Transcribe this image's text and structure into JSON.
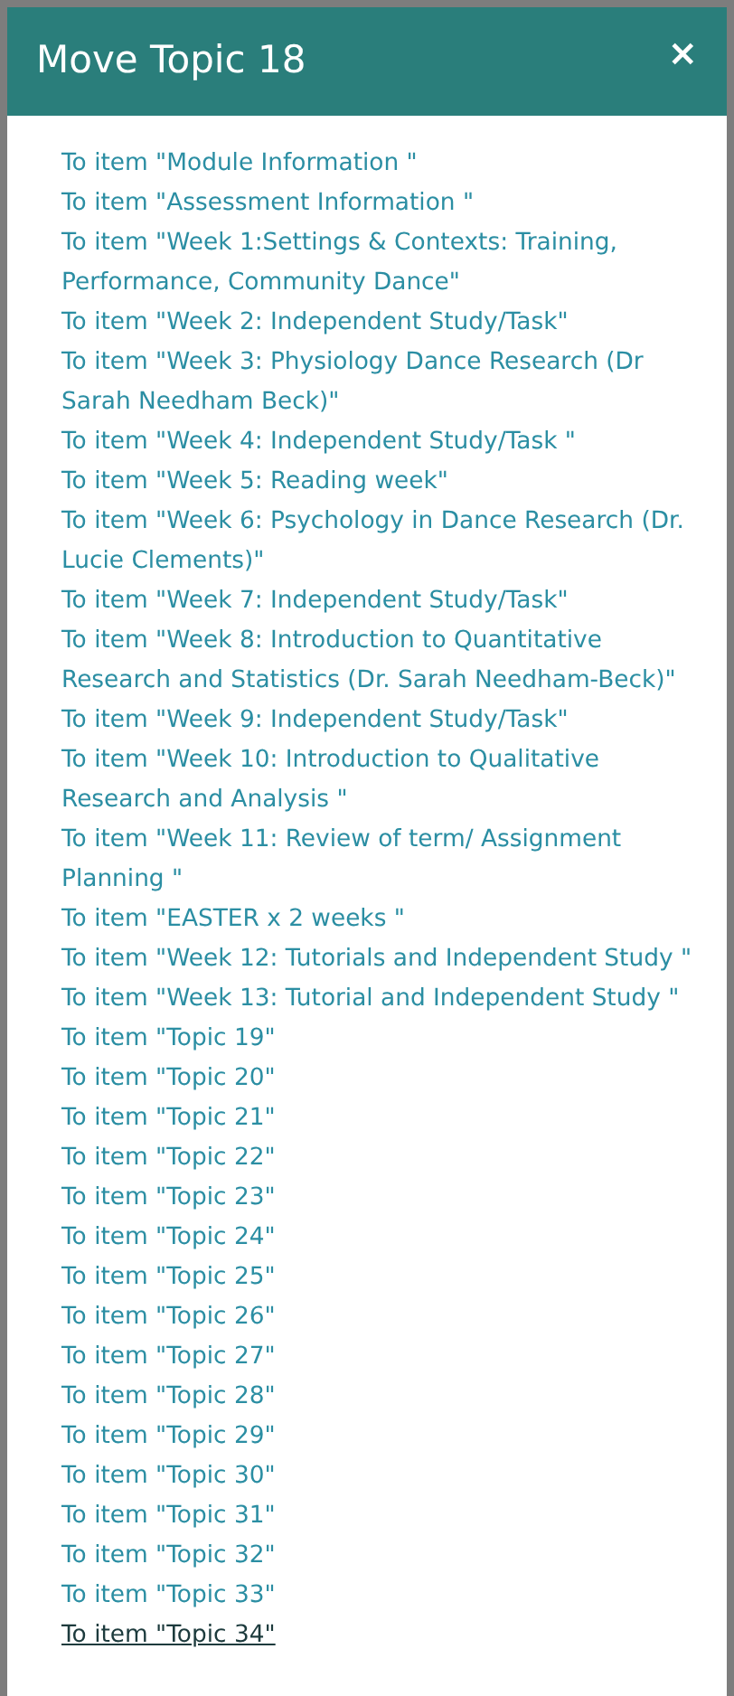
{
  "dialog": {
    "title": "Move Topic 18",
    "close_label": "×"
  },
  "items": [
    {
      "label": "To item \"Module Information \"",
      "hovered": false
    },
    {
      "label": "To item \"Assessment Information \"",
      "hovered": false
    },
    {
      "label": "To item \"Week 1:Settings & Contexts: Training, Performance, Community Dance\"",
      "hovered": false
    },
    {
      "label": "To item \"Week 2: Independent Study/Task\"",
      "hovered": false
    },
    {
      "label": "To item \"Week 3: Physiology Dance Research (Dr Sarah Needham Beck)\"",
      "hovered": false
    },
    {
      "label": "To item \"Week 4: Independent Study/Task \"",
      "hovered": false
    },
    {
      "label": "To item \"Week 5: Reading week\"",
      "hovered": false
    },
    {
      "label": "To item \"Week 6: Psychology in Dance Research (Dr. Lucie Clements)\"",
      "hovered": false
    },
    {
      "label": "To item \"Week 7: Independent Study/Task\"",
      "hovered": false
    },
    {
      "label": "To item \"Week 8: Introduction to Quantitative Research and Statistics (Dr. Sarah Needham-Beck)\"",
      "hovered": false
    },
    {
      "label": "To item \"Week 9: Independent Study/Task\"",
      "hovered": false
    },
    {
      "label": "To item \"Week 10: Introduction to Qualitative Research and Analysis \"",
      "hovered": false
    },
    {
      "label": "To item \"Week 11: Review of term/ Assignment Planning \"",
      "hovered": false
    },
    {
      "label": "To item \"EASTER x 2 weeks \"",
      "hovered": false
    },
    {
      "label": "To item \"Week 12: Tutorials and Independent Study \"",
      "hovered": false
    },
    {
      "label": "To item \"Week 13: Tutorial and Independent Study \"",
      "hovered": false
    },
    {
      "label": "To item \"Topic 19\"",
      "hovered": false
    },
    {
      "label": "To item \"Topic 20\"",
      "hovered": false
    },
    {
      "label": "To item \"Topic 21\"",
      "hovered": false
    },
    {
      "label": "To item \"Topic 22\"",
      "hovered": false
    },
    {
      "label": "To item \"Topic 23\"",
      "hovered": false
    },
    {
      "label": "To item \"Topic 24\"",
      "hovered": false
    },
    {
      "label": "To item \"Topic 25\"",
      "hovered": false
    },
    {
      "label": "To item \"Topic 26\"",
      "hovered": false
    },
    {
      "label": "To item \"Topic 27\"",
      "hovered": false
    },
    {
      "label": "To item \"Topic 28\"",
      "hovered": false
    },
    {
      "label": "To item \"Topic 29\"",
      "hovered": false
    },
    {
      "label": "To item \"Topic 30\"",
      "hovered": false
    },
    {
      "label": "To item \"Topic 31\"",
      "hovered": false
    },
    {
      "label": "To item \"Topic 32\"",
      "hovered": false
    },
    {
      "label": "To item \"Topic 33\"",
      "hovered": false
    },
    {
      "label": "To item \"Topic 34\"",
      "hovered": true
    }
  ]
}
